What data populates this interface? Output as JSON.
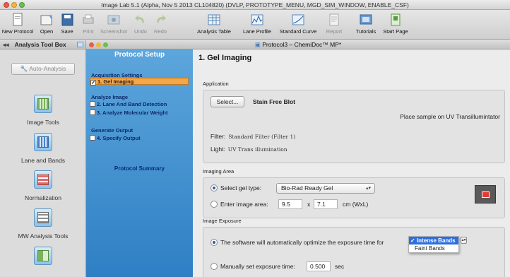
{
  "window": {
    "title": "Image Lab 5.1 (Alpha, Nov  5 2013 CL104820) (DVLP, PROTOTYPE_MENU, MGD_SIM_WINDOW, ENABLE_CSF)"
  },
  "toolbar": {
    "items": [
      {
        "label": "New Protocol",
        "icon": "new-protocol-icon",
        "enabled": true
      },
      {
        "label": "Open",
        "icon": "open-folder-icon",
        "enabled": true
      },
      {
        "label": "Save",
        "icon": "save-icon",
        "enabled": true
      },
      {
        "label": "Print",
        "icon": "print-icon",
        "enabled": false
      },
      {
        "label": "Screenshot",
        "icon": "screenshot-icon",
        "enabled": false
      },
      {
        "label": "Undo",
        "icon": "undo-icon",
        "enabled": false
      },
      {
        "label": "Redo",
        "icon": "redo-icon",
        "enabled": false
      },
      {
        "label": "Analysis Table",
        "icon": "analysis-table-icon",
        "enabled": true
      },
      {
        "label": "Lane Profile",
        "icon": "lane-profile-icon",
        "enabled": true
      },
      {
        "label": "Standard Curve",
        "icon": "standard-curve-icon",
        "enabled": true
      },
      {
        "label": "Report",
        "icon": "report-icon",
        "enabled": false
      },
      {
        "label": "Tutorials",
        "icon": "tutorials-icon",
        "enabled": true
      },
      {
        "label": "Start Page",
        "icon": "start-page-icon",
        "enabled": true
      }
    ]
  },
  "toolbox": {
    "title": "Analysis Tool Box",
    "auto_analysis": "Auto-Analysis",
    "tools": [
      {
        "label": "Image Tools"
      },
      {
        "label": "Lane and Bands"
      },
      {
        "label": "Normalization"
      },
      {
        "label": "MW Analysis Tools"
      }
    ]
  },
  "protocol_window": {
    "title": "Protocol3 – ChemiDoc™ MP*"
  },
  "protocol_setup": {
    "title": "Protocol Setup",
    "sections": [
      {
        "heading": "Acquisition Settings",
        "items": [
          {
            "label": "1. Gel Imaging",
            "checked": true,
            "active": true
          }
        ]
      },
      {
        "heading": "Analyze Image",
        "items": [
          {
            "label": "2. Lane And Band Detection",
            "checked": false,
            "active": false
          },
          {
            "label": "3. Analyze Molecular Weight",
            "checked": false,
            "active": false
          }
        ]
      },
      {
        "heading": "Generate Output",
        "items": [
          {
            "label": "4. Specify Output",
            "checked": false,
            "active": false
          }
        ]
      }
    ],
    "summary": "Protocol Summary"
  },
  "main": {
    "title": "1. Gel Imaging",
    "application": {
      "label": "Application",
      "select_button": "Select...",
      "stain": "Stain Free Blot",
      "hint": "Place sample on UV Transillumintator",
      "filter_label": "Filter:",
      "filter_value": "Standard Filter (Filter 1)",
      "light_label": "Light:",
      "light_value": "UV Trans illumination"
    },
    "imaging_area": {
      "label": "Imaging Area",
      "select_gel_label": "Select gel type:",
      "gel_type": "Bio-Rad Ready Gel",
      "enter_area_label": "Enter image area:",
      "width": "9.5",
      "times": "x",
      "height": "7.1",
      "unit": "cm (WxL)"
    },
    "image_exposure": {
      "label": "Image Exposure",
      "auto_label": "The software will automatically optimize the exposure time for",
      "options": [
        "Intense Bands",
        "Faint Bands"
      ],
      "selected_option": "Intense Bands",
      "manual_label": "Manually set exposure time:",
      "manual_value": "0.500",
      "manual_unit": "sec"
    }
  },
  "colors": {
    "panel_blue": "#2e7fc4",
    "active_item": "#f3a64a",
    "selection_blue": "#2d6ee0"
  }
}
